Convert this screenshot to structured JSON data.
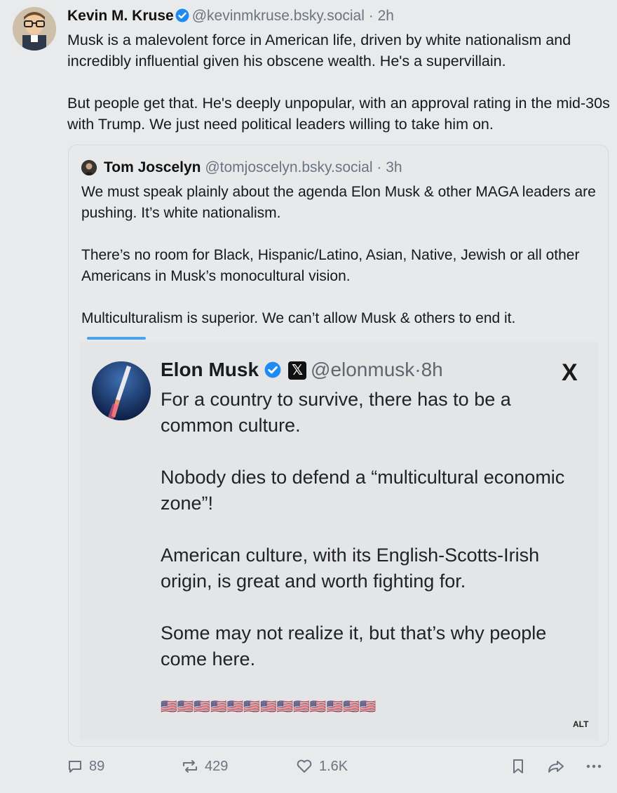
{
  "post": {
    "author_name": "Kevin M. Kruse",
    "handle": "@kevinmkruse.bsky.social",
    "separator": "·",
    "time": "2h",
    "text": "Musk is a malevolent force in American life, driven by white nationalism and incredibly influential given his obscene wealth. He's a supervillain.\n\nBut people get that. He's deeply unpopular, with an approval rating in the mid-30s with Trump. We just need political leaders willing to take him on."
  },
  "quote": {
    "author_name": "Tom Joscelyn",
    "handle": "@tomjoscelyn.bsky.social",
    "separator": "·",
    "time": "3h",
    "text": "We must speak plainly about the agenda Elon Musk & other MAGA leaders are pushing. It’s white nationalism.\n\nThere’s no room for Black, Hispanic/Latino, Asian, Native, Jewish or all other Americans in Musk’s monocultural vision.\n\nMulticulturalism is superior. We can’t allow Musk & others to end it."
  },
  "embedded": {
    "author_name": "Elon Musk",
    "handle": "@elonmusk",
    "separator": "·",
    "time": "8h",
    "x_logo": "X",
    "text": "For a country to survive, there has to be a common culture.\n\nNobody dies to defend a “multicultural economic zone”!\n\nAmerican culture, with its English-Scotts-Irish origin, is great and worth fighting for.\n\nSome may not realize it, but that’s why people come here.",
    "flags": "🇺🇸🇺🇸🇺🇸🇺🇸🇺🇸🇺🇸🇺🇸🇺🇸🇺🇸🇺🇸🇺🇸🇺🇸🇺🇸",
    "alt_label": "ALT"
  },
  "actions": {
    "replies": "89",
    "reposts": "429",
    "likes": "1.6K"
  },
  "colors": {
    "background": "#e9eaeb",
    "verified": "#1d8bf1",
    "muted": "#6b7582",
    "accent_bar": "#4ba3ee"
  }
}
